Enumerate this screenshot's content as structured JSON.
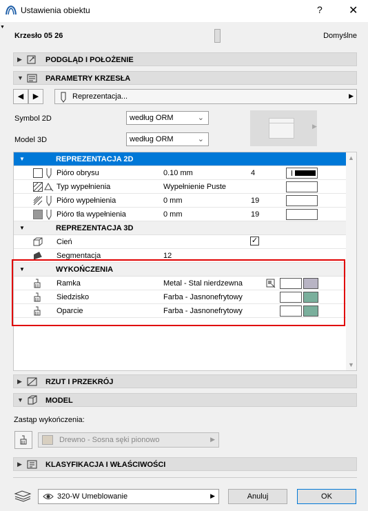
{
  "window": {
    "title": "Ustawienia obiektu",
    "help": "?",
    "close": "✕"
  },
  "header": {
    "object_name": "Krzesło 05 26",
    "default_label": "Domyślne"
  },
  "sections": {
    "preview_position": "PODGLĄD I POŁOŻENIE",
    "chair_params": "PARAMETRY KRZESŁA",
    "plan_section": "RZUT I PRZEKRÓJ",
    "model": "MODEL",
    "classification": "KLASYFIKACJA I WŁAŚCIWOŚCI"
  },
  "nav": {
    "page_label": "Reprezentacja..."
  },
  "fields": {
    "symbol2d_label": "Symbol 2D",
    "symbol2d_value": "według ORM",
    "model3d_label": "Model 3D",
    "model3d_value": "według ORM"
  },
  "table": {
    "group_2d": "REPREZENTACJA 2D",
    "rows_2d": [
      {
        "name": "Pióro obrysu",
        "value": "0.10 mm",
        "num": "4"
      },
      {
        "name": "Typ wypełnienia",
        "value": "Wypełnienie Puste",
        "num": ""
      },
      {
        "name": "Pióro wypełnienia",
        "value": "0 mm",
        "num": "19"
      },
      {
        "name": "Pióro tła wypełnienia",
        "value": "0 mm",
        "num": "19"
      }
    ],
    "group_3d": "REPREZENTACJA 3D",
    "rows_3d": [
      {
        "name": "Cień",
        "value": "",
        "checked": "✓"
      },
      {
        "name": "Segmentacja",
        "value": "12"
      }
    ],
    "group_finish": "WYKOŃCZENIA",
    "rows_finish": [
      {
        "name": "Ramka",
        "value": "Metal - Stal nierdzewna",
        "color": "#b8b4c4"
      },
      {
        "name": "Siedzisko",
        "value": "Farba - Jasnonefrytowy",
        "color": "#7aaf9c"
      },
      {
        "name": "Oparcie",
        "value": "Farba - Jasnonefrytowy",
        "color": "#7aaf9c"
      }
    ]
  },
  "override": {
    "label": "Zastąp wykończenia:",
    "value": "Drewno - Sosna sęki pionowo"
  },
  "footer": {
    "layer": "320-W Umeblowanie",
    "cancel": "Anuluj",
    "ok": "OK"
  },
  "colors": {
    "selection": "#0078d7",
    "highlight_box": "#e00000"
  }
}
